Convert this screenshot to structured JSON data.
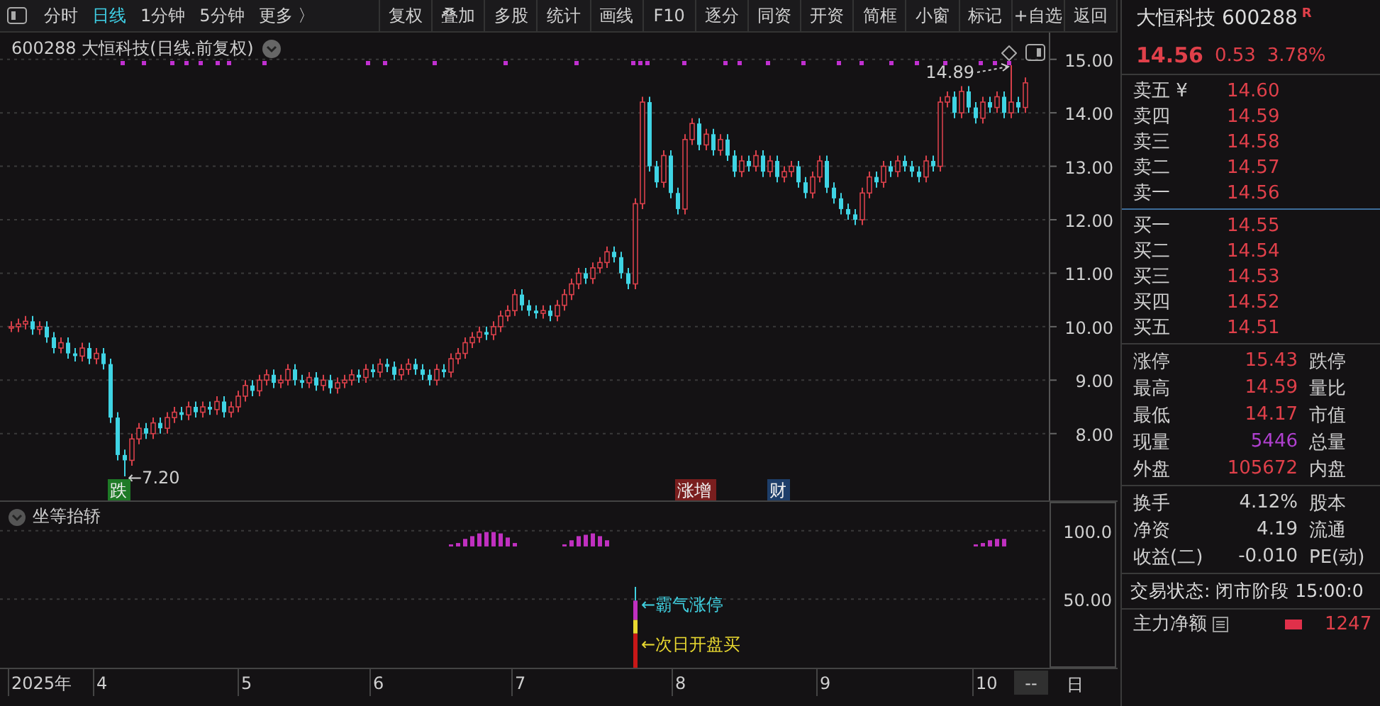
{
  "toolbar": {
    "tabs": [
      {
        "label": "分时",
        "selected": false
      },
      {
        "label": "日线",
        "selected": true
      },
      {
        "label": "1分钟",
        "selected": false
      },
      {
        "label": "5分钟",
        "selected": false
      },
      {
        "label": "更多 〉",
        "selected": false
      }
    ],
    "buttons": [
      "复权",
      "叠加",
      "多股",
      "统计",
      "画线",
      "F10",
      "逐分",
      "同资",
      "开资",
      "简框",
      "小窗",
      "标记",
      "+自选",
      "返回"
    ]
  },
  "main_chart": {
    "title": "600288 大恒科技(日线.前复权)",
    "chart_data": {
      "type": "candlestick",
      "ylim": [
        6.75,
        15.5
      ],
      "yticks": [
        {
          "value": 15,
          "label": "15.00"
        },
        {
          "value": 14,
          "label": "14.00"
        },
        {
          "value": 13,
          "label": "13.00"
        },
        {
          "value": 12,
          "label": "12.00"
        },
        {
          "value": 11,
          "label": "11.00"
        },
        {
          "value": 10,
          "label": "10.00"
        },
        {
          "value": 9,
          "label": "9.00"
        },
        {
          "value": 8,
          "label": "8.00"
        }
      ],
      "grid": true,
      "ohlc": [
        [
          10.0,
          10.1,
          9.9,
          10.0
        ],
        [
          10.0,
          10.15,
          9.9,
          10.05
        ],
        [
          10.05,
          10.2,
          9.95,
          10.1
        ],
        [
          10.1,
          10.2,
          9.85,
          9.95
        ],
        [
          9.95,
          10.1,
          9.85,
          10.0
        ],
        [
          10.0,
          10.1,
          9.7,
          9.8
        ],
        [
          9.8,
          9.9,
          9.5,
          9.6
        ],
        [
          9.6,
          9.8,
          9.5,
          9.7
        ],
        [
          9.7,
          9.8,
          9.4,
          9.5
        ],
        [
          9.5,
          9.6,
          9.35,
          9.45
        ],
        [
          9.45,
          9.7,
          9.35,
          9.6
        ],
        [
          9.6,
          9.7,
          9.3,
          9.4
        ],
        [
          9.4,
          9.6,
          9.3,
          9.5
        ],
        [
          9.5,
          9.6,
          9.2,
          9.3
        ],
        [
          9.3,
          9.4,
          8.2,
          8.3
        ],
        [
          8.3,
          8.4,
          7.5,
          7.6
        ],
        [
          7.6,
          7.7,
          7.2,
          7.5
        ],
        [
          7.5,
          8.0,
          7.4,
          7.9
        ],
        [
          7.9,
          8.2,
          7.8,
          8.1
        ],
        [
          8.1,
          8.2,
          7.9,
          8.0
        ],
        [
          8.0,
          8.3,
          7.9,
          8.2
        ],
        [
          8.2,
          8.3,
          8.0,
          8.1
        ],
        [
          8.1,
          8.4,
          8.0,
          8.3
        ],
        [
          8.3,
          8.5,
          8.2,
          8.4
        ],
        [
          8.4,
          8.5,
          8.25,
          8.35
        ],
        [
          8.35,
          8.6,
          8.25,
          8.5
        ],
        [
          8.5,
          8.6,
          8.3,
          8.4
        ],
        [
          8.4,
          8.6,
          8.3,
          8.5
        ],
        [
          8.5,
          8.6,
          8.35,
          8.45
        ],
        [
          8.45,
          8.7,
          8.35,
          8.6
        ],
        [
          8.6,
          8.7,
          8.3,
          8.4
        ],
        [
          8.4,
          8.6,
          8.3,
          8.5
        ],
        [
          8.5,
          8.8,
          8.4,
          8.7
        ],
        [
          8.7,
          9.0,
          8.6,
          8.9
        ],
        [
          8.9,
          9.0,
          8.7,
          8.8
        ],
        [
          8.8,
          9.1,
          8.7,
          9.0
        ],
        [
          9.0,
          9.2,
          8.9,
          9.1
        ],
        [
          9.1,
          9.2,
          8.85,
          8.95
        ],
        [
          8.95,
          9.1,
          8.85,
          9.0
        ],
        [
          9.0,
          9.3,
          8.9,
          9.2
        ],
        [
          9.2,
          9.3,
          8.9,
          9.0
        ],
        [
          9.0,
          9.1,
          8.85,
          8.95
        ],
        [
          8.95,
          9.15,
          8.85,
          9.05
        ],
        [
          9.05,
          9.15,
          8.8,
          8.9
        ],
        [
          8.9,
          9.1,
          8.8,
          9.0
        ],
        [
          9.0,
          9.1,
          8.75,
          8.85
        ],
        [
          8.85,
          9.05,
          8.75,
          8.95
        ],
        [
          8.95,
          9.1,
          8.85,
          9.0
        ],
        [
          9.0,
          9.2,
          8.9,
          9.1
        ],
        [
          9.1,
          9.2,
          8.95,
          9.05
        ],
        [
          9.05,
          9.3,
          8.95,
          9.2
        ],
        [
          9.2,
          9.3,
          9.05,
          9.15
        ],
        [
          9.15,
          9.4,
          9.05,
          9.3
        ],
        [
          9.3,
          9.4,
          9.15,
          9.25
        ],
        [
          9.25,
          9.35,
          9.0,
          9.1
        ],
        [
          9.1,
          9.3,
          9.0,
          9.2
        ],
        [
          9.2,
          9.4,
          9.1,
          9.3
        ],
        [
          9.3,
          9.4,
          9.1,
          9.2
        ],
        [
          9.2,
          9.3,
          9.0,
          9.1
        ],
        [
          9.1,
          9.2,
          8.9,
          9.0
        ],
        [
          9.0,
          9.3,
          8.9,
          9.2
        ],
        [
          9.2,
          9.3,
          9.05,
          9.15
        ],
        [
          9.15,
          9.5,
          9.05,
          9.4
        ],
        [
          9.4,
          9.6,
          9.3,
          9.5
        ],
        [
          9.5,
          9.8,
          9.4,
          9.7
        ],
        [
          9.7,
          9.9,
          9.6,
          9.8
        ],
        [
          9.8,
          10.0,
          9.7,
          9.9
        ],
        [
          9.9,
          10.0,
          9.75,
          9.85
        ],
        [
          9.85,
          10.1,
          9.75,
          10.0
        ],
        [
          10.0,
          10.3,
          9.9,
          10.2
        ],
        [
          10.2,
          10.4,
          10.1,
          10.3
        ],
        [
          10.3,
          10.7,
          10.2,
          10.6
        ],
        [
          10.6,
          10.7,
          10.3,
          10.4
        ],
        [
          10.4,
          10.5,
          10.2,
          10.3
        ],
        [
          10.3,
          10.4,
          10.15,
          10.25
        ],
        [
          10.25,
          10.4,
          10.15,
          10.3
        ],
        [
          10.3,
          10.4,
          10.1,
          10.2
        ],
        [
          10.2,
          10.5,
          10.1,
          10.4
        ],
        [
          10.4,
          10.7,
          10.3,
          10.6
        ],
        [
          10.6,
          10.9,
          10.5,
          10.8
        ],
        [
          10.8,
          11.1,
          10.7,
          11.0
        ],
        [
          11.0,
          11.1,
          10.8,
          10.9
        ],
        [
          10.9,
          11.2,
          10.8,
          11.1
        ],
        [
          11.1,
          11.3,
          11.0,
          11.2
        ],
        [
          11.2,
          11.5,
          11.1,
          11.4
        ],
        [
          11.4,
          11.5,
          11.2,
          11.3
        ],
        [
          11.3,
          11.4,
          10.9,
          11.0
        ],
        [
          11.0,
          11.1,
          10.7,
          10.8
        ],
        [
          10.8,
          12.4,
          10.7,
          12.3
        ],
        [
          12.3,
          14.3,
          12.2,
          14.2
        ],
        [
          14.2,
          14.3,
          12.9,
          13.0
        ],
        [
          13.0,
          13.1,
          12.6,
          12.7
        ],
        [
          12.7,
          13.3,
          12.6,
          13.2
        ],
        [
          13.2,
          13.3,
          12.4,
          12.5
        ],
        [
          12.5,
          12.6,
          12.1,
          12.2
        ],
        [
          12.2,
          13.6,
          12.1,
          13.5
        ],
        [
          13.5,
          13.9,
          13.4,
          13.8
        ],
        [
          13.8,
          13.9,
          13.3,
          13.4
        ],
        [
          13.4,
          13.7,
          13.3,
          13.6
        ],
        [
          13.6,
          13.7,
          13.2,
          13.3
        ],
        [
          13.3,
          13.6,
          13.2,
          13.5
        ],
        [
          13.5,
          13.6,
          13.1,
          13.2
        ],
        [
          13.2,
          13.3,
          12.8,
          12.9
        ],
        [
          12.9,
          13.2,
          12.8,
          13.1
        ],
        [
          13.1,
          13.2,
          12.9,
          13.0
        ],
        [
          13.0,
          13.3,
          12.9,
          13.2
        ],
        [
          13.2,
          13.3,
          12.8,
          12.9
        ],
        [
          12.9,
          13.2,
          12.8,
          13.1
        ],
        [
          13.1,
          13.2,
          12.7,
          12.8
        ],
        [
          12.8,
          13.0,
          12.7,
          12.9
        ],
        [
          12.9,
          13.1,
          12.8,
          13.0
        ],
        [
          13.0,
          13.1,
          12.6,
          12.7
        ],
        [
          12.7,
          12.8,
          12.4,
          12.5
        ],
        [
          12.5,
          12.9,
          12.4,
          12.8
        ],
        [
          12.8,
          13.2,
          12.7,
          13.1
        ],
        [
          13.1,
          13.2,
          12.5,
          12.6
        ],
        [
          12.6,
          12.7,
          12.3,
          12.4
        ],
        [
          12.4,
          12.5,
          12.1,
          12.2
        ],
        [
          12.2,
          12.3,
          12.0,
          12.1
        ],
        [
          12.1,
          12.2,
          11.9,
          12.0
        ],
        [
          12.0,
          12.6,
          11.9,
          12.5
        ],
        [
          12.5,
          12.9,
          12.4,
          12.8
        ],
        [
          12.8,
          12.9,
          12.6,
          12.7
        ],
        [
          12.7,
          13.1,
          12.6,
          13.0
        ],
        [
          13.0,
          13.1,
          12.8,
          12.9
        ],
        [
          12.9,
          13.2,
          12.8,
          13.1
        ],
        [
          13.1,
          13.2,
          12.9,
          13.0
        ],
        [
          13.0,
          13.1,
          12.8,
          12.9
        ],
        [
          12.9,
          13.0,
          12.7,
          12.8
        ],
        [
          12.8,
          13.2,
          12.7,
          13.1
        ],
        [
          13.1,
          13.2,
          12.9,
          13.0
        ],
        [
          13.0,
          14.3,
          12.9,
          14.2
        ],
        [
          14.2,
          14.4,
          14.1,
          14.3
        ],
        [
          14.3,
          14.4,
          13.9,
          14.0
        ],
        [
          14.0,
          14.5,
          13.9,
          14.4
        ],
        [
          14.4,
          14.5,
          14.0,
          14.1
        ],
        [
          14.1,
          14.2,
          13.8,
          13.9
        ],
        [
          13.9,
          14.3,
          13.8,
          14.2
        ],
        [
          14.2,
          14.3,
          14.0,
          14.1
        ],
        [
          14.1,
          14.4,
          14.0,
          14.3
        ],
        [
          14.3,
          14.4,
          13.9,
          14.0
        ],
        [
          14.0,
          14.89,
          13.9,
          14.2
        ],
        [
          14.2,
          14.3,
          14.0,
          14.1
        ],
        [
          14.1,
          14.66,
          14.0,
          14.56
        ]
      ],
      "annotations": [
        "14.89",
        "←7.20"
      ]
    },
    "tags": [
      {
        "text": "跌",
        "color": "#1e7a26"
      },
      {
        "text": "涨增",
        "color": "#7a1e1e"
      },
      {
        "text": "财",
        "color": "#1e3e6a"
      }
    ]
  },
  "indicator": {
    "title": "坐等抬轿",
    "y_labels": [
      "100.0",
      "50.00"
    ],
    "signals": [
      {
        "text": "←霸气涨停",
        "color": "#40d0e0"
      },
      {
        "text": "←次日开盘买",
        "color": "#e8d830"
      }
    ],
    "x_labels": [
      "2025年",
      "4",
      "5",
      "6",
      "7",
      "8",
      "9",
      "10"
    ],
    "range_button": "--",
    "period_label": "日"
  },
  "quote": {
    "name": "大恒科技 600288",
    "badge": "R",
    "price": "14.56",
    "change": "0.53",
    "change_pct": "3.78%",
    "asks": [
      {
        "label": "卖五 ¥",
        "price": "14.60"
      },
      {
        "label": "卖四",
        "price": "14.59"
      },
      {
        "label": "卖三",
        "price": "14.58"
      },
      {
        "label": "卖二",
        "price": "14.57"
      },
      {
        "label": "卖一",
        "price": "14.56"
      }
    ],
    "bids": [
      {
        "label": "买一",
        "price": "14.55"
      },
      {
        "label": "买二",
        "price": "14.54"
      },
      {
        "label": "买三",
        "price": "14.53"
      },
      {
        "label": "买四",
        "price": "14.52"
      },
      {
        "label": "买五",
        "price": "14.51"
      }
    ],
    "stats": [
      {
        "label": "涨停",
        "value": "15.43",
        "color": "#e0404a",
        "label_2": "跌停"
      },
      {
        "label": "最高",
        "value": "14.59",
        "color": "#e0404a",
        "label_2": "量比"
      },
      {
        "label": "最低",
        "value": "14.17",
        "color": "#e0404a",
        "label_2": "市值"
      },
      {
        "label": "现量",
        "value": "5446",
        "color": "#b040d0",
        "label_2": "总量"
      },
      {
        "label": "外盘",
        "value": "105672",
        "color": "#e0404a",
        "label_2": "内盘"
      }
    ],
    "stats_2": [
      {
        "label": "换手",
        "value": "4.12%",
        "color": "#d0d0d0",
        "label_2": "股本"
      },
      {
        "label": "净资",
        "value": "4.19",
        "color": "#d0d0d0",
        "label_2": "流通"
      },
      {
        "label": "收益(二)",
        "value": "-0.010",
        "color": "#d0d0d0",
        "label_2": "PE(动)"
      }
    ],
    "status": "交易状态: 闭市阶段 15:00:0",
    "flow": {
      "label": "主力净额",
      "value": "1247"
    }
  }
}
